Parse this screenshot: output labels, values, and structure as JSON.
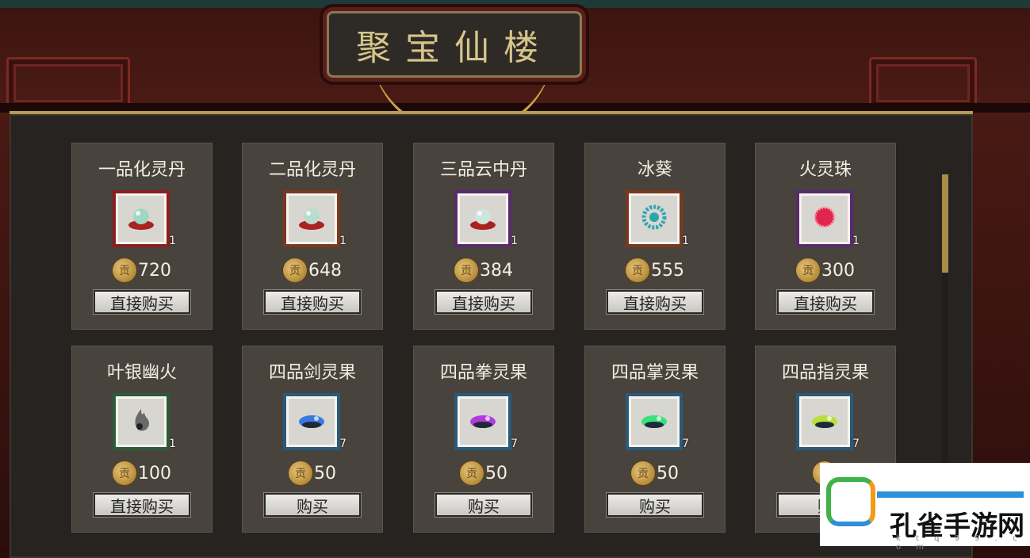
{
  "shop": {
    "title": "聚宝仙楼",
    "items": [
      {
        "name": "一品化灵丹",
        "qty": "1",
        "price": "720",
        "button": "直接购买",
        "frame": "#8b1e1e",
        "icon": "pill-icon",
        "icon_color": "#9fd7c0"
      },
      {
        "name": "二品化灵丹",
        "qty": "1",
        "price": "648",
        "button": "直接购买",
        "frame": "#7a3820",
        "icon": "pill-icon",
        "icon_color": "#b9dccf"
      },
      {
        "name": "三品云中丹",
        "qty": "1",
        "price": "384",
        "button": "直接购买",
        "frame": "#5a2a6e",
        "icon": "pill-icon",
        "icon_color": "#d0e4da"
      },
      {
        "name": "冰葵",
        "qty": "1",
        "price": "555",
        "button": "直接购买",
        "frame": "#7a3820",
        "icon": "flower-icon",
        "icon_color": "#2aa6b0"
      },
      {
        "name": "火灵珠",
        "qty": "1",
        "price": "300",
        "button": "直接购买",
        "frame": "#5a2a6e",
        "icon": "orb-icon",
        "icon_color": "#e0264a"
      },
      {
        "name": "叶银幽火",
        "qty": "1",
        "price": "100",
        "button": "直接购买",
        "frame": "#2f5a3a",
        "icon": "flame-icon",
        "icon_color": "#6a6a6a"
      },
      {
        "name": "四品剑灵果",
        "qty": "7",
        "price": "50",
        "button": "购买",
        "frame": "#2a5a7a",
        "icon": "fruit-icon",
        "icon_color": "#3a7ae0"
      },
      {
        "name": "四品拳灵果",
        "qty": "7",
        "price": "50",
        "button": "购买",
        "frame": "#2a5a7a",
        "icon": "fruit-icon",
        "icon_color": "#b23ae0"
      },
      {
        "name": "四品掌灵果",
        "qty": "7",
        "price": "50",
        "button": "购买",
        "frame": "#2a5a7a",
        "icon": "fruit-icon",
        "icon_color": "#3ae07a"
      },
      {
        "name": "四品指灵果",
        "qty": "7",
        "price": "",
        "button": "购",
        "frame": "#2a5a7a",
        "icon": "fruit-icon",
        "icon_color": "#b6e03a"
      }
    ]
  },
  "currency": {
    "glyph": "贡",
    "icon": "coin-icon"
  },
  "watermark": {
    "text": "孔雀手游网",
    "url": "k t q 9 9 . c o m"
  }
}
